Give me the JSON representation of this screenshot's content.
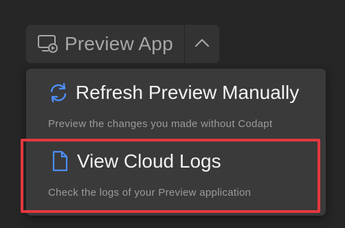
{
  "split_button": {
    "label": "Preview App",
    "icon": "preview-monitor-icon",
    "toggle_icon": "chevron-up-icon"
  },
  "menu": {
    "items": [
      {
        "title": "Refresh Preview Manually",
        "description": "Preview the changes you made without Codapt",
        "icon": "refresh-icon"
      },
      {
        "title": "View Cloud Logs",
        "description": "Check the logs of your Preview application",
        "icon": "document-icon"
      }
    ]
  },
  "colors": {
    "background": "#262626",
    "button": "#333333",
    "menu": "#3a3a3a",
    "accent_blue": "#4d8ef7",
    "highlight": "#e5383f"
  }
}
